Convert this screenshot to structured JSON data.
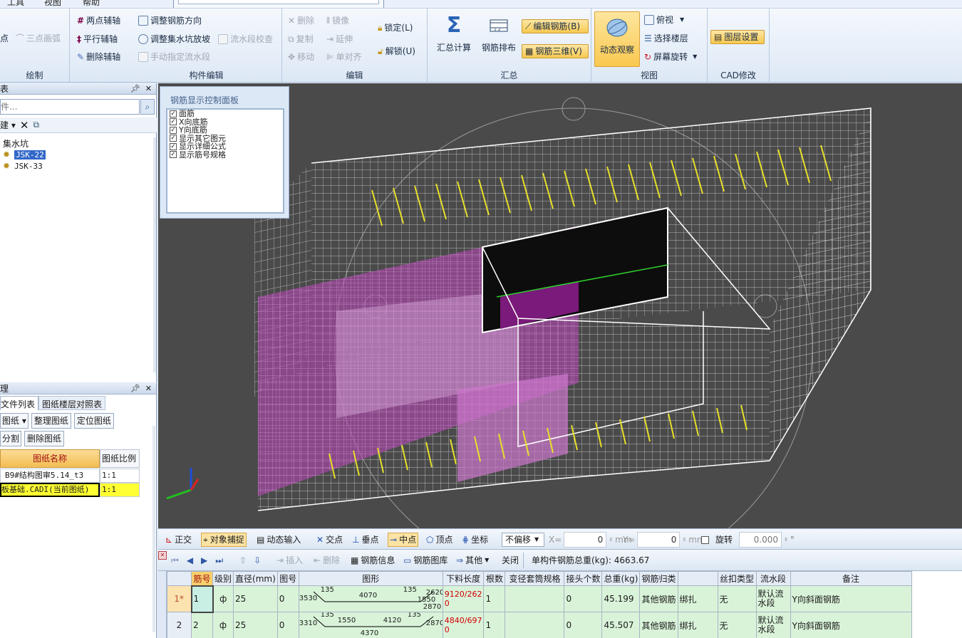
{
  "menu": {
    "items": [
      "工具",
      "视图",
      "帮助"
    ]
  },
  "ribbon": {
    "groups": {
      "draw": {
        "label": "绘制",
        "items": {
          "point": "点",
          "three_point_arc": "三点画弧"
        }
      },
      "aux": {
        "items": {
          "two_point": "两点辅轴",
          "parallel": "平行辅轴",
          "delete": "删除辅轴"
        }
      },
      "component_edit": {
        "label": "构件编辑",
        "items": {
          "adjust_direction": "调整钢筋方向",
          "adjust_slope": "调整集水坑放坡",
          "manual_flow": "手动指定流水段",
          "flow_check": "流水段校查"
        }
      },
      "edit": {
        "label": "编辑",
        "items": {
          "delete": "删除",
          "mirror": "镜像",
          "copy": "复制",
          "extend": "延伸",
          "move": "移动",
          "align": "单对齐",
          "lock": "锁定(L)",
          "unlock": "解锁(U)"
        }
      },
      "summary": {
        "label": "汇总",
        "items": {
          "calc": "汇总计算",
          "arrange": "钢筋排布",
          "edit_rebar": "编辑钢筋(B)",
          "rebar_3d": "钢筋三维(V)"
        }
      },
      "view": {
        "label": "视图",
        "items": {
          "dynamic": "动态观察",
          "top_view": "俯视",
          "select_floor": "选择楼层",
          "screen_rotate": "屏幕旋转"
        }
      },
      "cad": {
        "label": "CAD修改",
        "items": {
          "layer_settings": "图层设置"
        }
      }
    }
  },
  "left_top_pane": {
    "title": "表",
    "search_placeholder": "件...",
    "new_label": "建",
    "tree": {
      "root": "集水坑",
      "children": [
        "JSK-22",
        "JSK-33"
      ]
    }
  },
  "left_bottom_pane": {
    "title": "理",
    "tabs": [
      "文件列表",
      "图纸楼层对照表"
    ],
    "buttons": [
      "图纸",
      "整理图纸",
      "定位图纸",
      "分割",
      "删除图纸"
    ],
    "table": {
      "headers": [
        "图纸名称",
        "图纸比例"
      ],
      "rows": [
        {
          "name": "B9#结构图审5.14_t3",
          "scale": "1:1"
        },
        {
          "name": "板基础.CADI(当前图纸)",
          "scale": "1:1"
        }
      ]
    }
  },
  "viewport": {
    "panel": {
      "title": "钢筋显示控制面板",
      "options": [
        "面筋",
        "X向底筋",
        "Y向底筋",
        "显示其它图元",
        "显示详细公式",
        "显示筋号规格"
      ]
    }
  },
  "snap_toolbar": {
    "items": [
      "正交",
      "对象捕捉",
      "动态输入",
      "交点",
      "垂点",
      "中点",
      "顶点",
      "坐标"
    ],
    "offset_mode": "不偏移",
    "x_label": "X=",
    "x_value": "0",
    "x_unit": "mm",
    "y_label": "Y=",
    "y_value": "0",
    "y_unit": "mm",
    "rotate_label": "旋转",
    "rotate_value": "0.000",
    "degree": "°"
  },
  "grid_toolbar": {
    "insert": "插入",
    "delete": "删除",
    "rebar_info": "钢筋信息",
    "rebar_library": "钢筋图库",
    "other": "其他",
    "close": "关闭",
    "total_label": "单构件钢筋总重(kg): 4663.67"
  },
  "grid": {
    "headers": [
      "筋号",
      "级别",
      "直径(mm)",
      "图号",
      "图形",
      "下料长度",
      "根数",
      "变径套筒规格",
      "接头个数",
      "总重(kg)",
      "钢筋归类",
      "",
      "丝扣类型",
      "流水段",
      "备注"
    ],
    "rows": [
      {
        "row_no": "1*",
        "id": "1",
        "grade": "ф",
        "diameter": "25",
        "fig": "0",
        "shape": {
          "left": "3530",
          "angle1": "135",
          "mid": "4070",
          "angle2": "135",
          "right": "2620",
          "r2": "1550",
          "r3": "2870"
        },
        "cut_length": "9120/262",
        "cut_length2": "0",
        "count": "1",
        "coupler": "",
        "joints": "0",
        "weight": "45.199",
        "category": "其他钢筋",
        "bind": "绑扎",
        "thread": "无",
        "flow": "默认流水段",
        "remark": "Y向斜面钢筋"
      },
      {
        "row_no": "2",
        "id": "2",
        "grade": "ф",
        "diameter": "25",
        "fig": "0",
        "shape": {
          "left": "3310",
          "angle1": "135",
          "mid1": "1550",
          "mid2": "4120",
          "angle2": "135",
          "right": "2870",
          "bottom": "4370"
        },
        "cut_length": "4840/697",
        "cut_length2": "0",
        "count": "1",
        "coupler": "",
        "joints": "0",
        "weight": "45.507",
        "category": "其他钢筋",
        "bind": "绑扎",
        "thread": "无",
        "flow": "默认流水段",
        "remark": "Y向斜面钢筋"
      }
    ]
  },
  "colors": {
    "accent": "#f9c84f",
    "grid_row": "#d9f3d9",
    "viewport_bg": "#4a4a4a",
    "rebar_yellow": "#e7e02a",
    "slab_magenta": "#c060c0"
  }
}
